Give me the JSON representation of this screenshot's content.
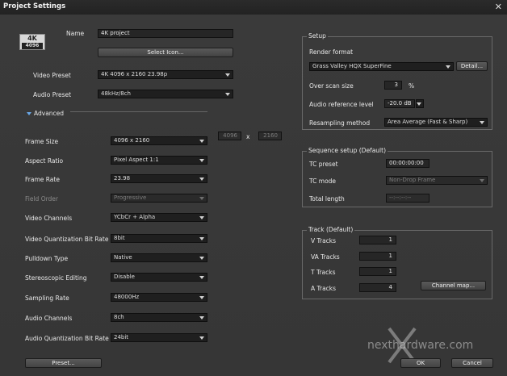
{
  "window": {
    "title": "Project Settings",
    "close_glyph": "✕"
  },
  "logo": {
    "line1": "4K",
    "line2": "4096"
  },
  "name": {
    "label": "Name",
    "value": "4K project"
  },
  "select_icon_button": "Select Icon...",
  "video_preset": {
    "label": "Video Preset",
    "value": "4K 4096 x 2160 23.98p"
  },
  "audio_preset": {
    "label": "Audio Preset",
    "value": "48kHz/8ch"
  },
  "advanced": {
    "label": "Advanced"
  },
  "left_fields": [
    {
      "label": "Frame Size",
      "value": "4096 x 2160",
      "disabled": false
    },
    {
      "label": "Aspect Ratio",
      "value": "Pixel Aspect 1:1",
      "disabled": false
    },
    {
      "label": "Frame Rate",
      "value": "23.98",
      "disabled": false
    },
    {
      "label": "Field Order",
      "value": "Progressive",
      "disabled": true
    },
    {
      "label": "Video Channels",
      "value": "YCbCr + Alpha",
      "disabled": false
    },
    {
      "label": "Video Quantization Bit Rate",
      "value": "8bit",
      "disabled": false
    },
    {
      "label": "Pulldown Type",
      "value": "Native",
      "disabled": false
    },
    {
      "label": "Stereoscopic Editing",
      "value": "Disable",
      "disabled": false
    },
    {
      "label": "Sampling Rate",
      "value": "48000Hz",
      "disabled": false
    },
    {
      "label": "Audio Channels",
      "value": "8ch",
      "disabled": false
    },
    {
      "label": "Audio Quantization Bit Rate",
      "value": "24bit",
      "disabled": false
    }
  ],
  "frame_size_custom": {
    "width": "4096",
    "x": "x",
    "height": "2160"
  },
  "preset_button": "Preset...",
  "setup": {
    "title": "Setup",
    "render_format_label": "Render format",
    "render_format_value": "Grass Valley HQX SuperFine",
    "detail_button": "Detail...",
    "overscan_label": "Over scan size",
    "overscan_value": "3",
    "overscan_unit": "%",
    "audio_ref_label": "Audio reference level",
    "audio_ref_value": "-20.0 dB",
    "resampling_label": "Resampling method",
    "resampling_value": "Area Average (Fast & Sharp)"
  },
  "sequence": {
    "title": "Sequence setup (Default)",
    "tc_preset_label": "TC preset",
    "tc_preset_value": "00:00:00:00",
    "tc_mode_label": "TC mode",
    "tc_mode_value": "Non-Drop Frame",
    "total_length_label": "Total length",
    "total_length_value": "--:--:--:--"
  },
  "track": {
    "title": "Track (Default)",
    "rows": [
      {
        "label": "V Tracks",
        "value": "1"
      },
      {
        "label": "VA Tracks",
        "value": "1"
      },
      {
        "label": "T Tracks",
        "value": "1"
      },
      {
        "label": "A Tracks",
        "value": "4"
      }
    ],
    "channel_map_button": "Channel map..."
  },
  "ok_button": "OK",
  "cancel_button": "Cancel",
  "watermark": "nexthardware.com"
}
